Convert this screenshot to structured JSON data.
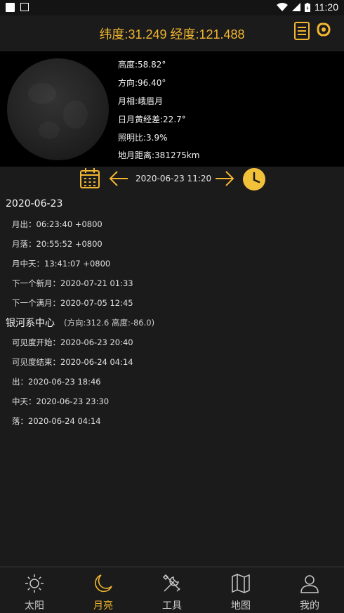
{
  "status_bar": {
    "time": "11:20"
  },
  "header": {
    "coords": "纬度:31.249 经度:121.488"
  },
  "moon_info": {
    "altitude": "高度:58.82°",
    "direction": "方向:96.40°",
    "phase": "月相:峨眉月",
    "elongation": "日月黄经差:22.7°",
    "illumination": "照明比:3.9%",
    "distance": "地月距离:381275km"
  },
  "date_nav": {
    "datetime": "2020-06-23 11:20"
  },
  "day": {
    "title": "2020-06-23",
    "moonrise": "月出：06:23:40 +0800",
    "moonset": "月落：20:55:52 +0800",
    "transit": "月中天：13:41:07 +0800",
    "next_new": "下一个新月：2020-07-21 01:33",
    "next_full": "下一个满月：2020-07-05 12:45"
  },
  "galaxy": {
    "title": "银河系中心",
    "subtitle": "(方向:312.6 高度:-86.0)",
    "visible_start": "可见度开始：2020-06-23 20:40",
    "visible_end": "可见度结束：2020-06-24 04:14",
    "rise": "出：2020-06-23 18:46",
    "transit": "中天：2020-06-23 23:30",
    "set": "落：2020-06-24 04:14"
  },
  "tabs": [
    {
      "label": "太阳",
      "icon": "sun-icon"
    },
    {
      "label": "月亮",
      "icon": "moon-icon"
    },
    {
      "label": "工具",
      "icon": "tools-icon"
    },
    {
      "label": "地图",
      "icon": "map-icon"
    },
    {
      "label": "我的",
      "icon": "user-icon"
    }
  ],
  "colors": {
    "accent": "#f2b630",
    "background": "#1b1b1b",
    "panel": "#000000"
  }
}
